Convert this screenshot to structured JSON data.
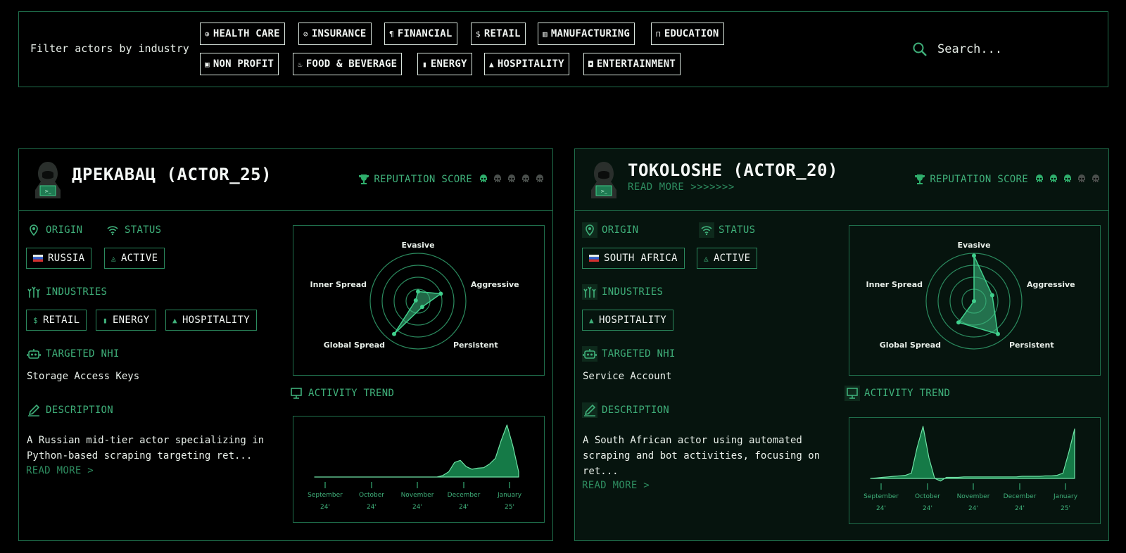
{
  "filter": {
    "label": "Filter actors by industry",
    "chips_row1": [
      {
        "icon": "health-icon",
        "glyph": "⊕",
        "label": "HEALTH CARE"
      },
      {
        "icon": "insurance-icon",
        "glyph": "⊘",
        "label": "INSURANCE"
      },
      {
        "icon": "financial-icon",
        "glyph": "¶",
        "label": "FINANCIAL"
      },
      {
        "icon": "dollar-icon",
        "glyph": "$",
        "label": "RETAIL"
      },
      {
        "icon": "factory-icon",
        "glyph": "▥",
        "label": "MANUFACTURING"
      },
      {
        "icon": "bookmark-icon",
        "glyph": "⊓",
        "label": "EDUCATION"
      }
    ],
    "chips_row2": [
      {
        "icon": "nonprofit-icon",
        "glyph": "▣",
        "label": "NON PROFIT"
      },
      {
        "icon": "food-icon",
        "glyph": "♨",
        "label": "FOOD & BEVERAGE"
      },
      {
        "icon": "battery-icon",
        "glyph": "▮",
        "label": "ENERGY"
      },
      {
        "icon": "bell-desk-icon",
        "glyph": "▲",
        "label": "HOSPITALITY"
      },
      {
        "icon": "ticket-icon",
        "glyph": "◘",
        "label": "ENTERTAINMENT"
      }
    ],
    "search_placeholder": "Search..."
  },
  "actors": [
    {
      "name": "ДРЕКАВАЦ (ACTOR_25)",
      "read_more_header": "",
      "reputation_label": "REPUTATION SCORE",
      "reputation_score": 1,
      "reputation_max": 5,
      "origin_label": "ORIGIN",
      "origin": "RUSSIA",
      "status_label": "STATUS",
      "status": "ACTIVE",
      "industries_label": "INDUSTRIES",
      "industries": [
        {
          "glyph": "$",
          "label": "RETAIL"
        },
        {
          "glyph": "▮",
          "label": "ENERGY"
        },
        {
          "glyph": "▲",
          "label": "HOSPITALITY"
        }
      ],
      "nhi_label": "TARGETED NHI",
      "nhi": "Storage Access Keys",
      "description_label": "DESCRIPTION",
      "description": "A Russian mid-tier actor specializing in Python-based scraping targeting ret...",
      "read_more": "READ MORE >",
      "radar": {
        "axes": [
          "Evasive",
          "Aggressive",
          "Persistent",
          "Global Spread",
          "Inner Spread"
        ],
        "values": [
          0.2,
          0.5,
          0.15,
          0.85,
          0.05
        ]
      },
      "trend_label": "ACTIVITY TREND",
      "trend": {
        "months": [
          "September",
          "October",
          "November",
          "December",
          "January"
        ],
        "years": [
          "24'",
          "24'",
          "24'",
          "24'",
          "25'"
        ],
        "values": [
          0,
          0,
          0,
          0,
          0,
          0,
          0,
          0,
          0,
          0,
          0,
          0,
          0,
          0,
          0,
          0,
          0,
          0,
          0,
          0,
          0,
          0,
          0.03,
          0.1,
          0.28,
          0.32,
          0.2,
          0.15,
          0.17,
          0.18,
          0.25,
          0.36,
          0.7,
          1.0,
          0.6,
          0.1
        ]
      }
    },
    {
      "name": "TOKOLOSHE (ACTOR_20)",
      "read_more_header": "READ MORE >>>>>>>",
      "reputation_label": "REPUTATION SCORE",
      "reputation_score": 3,
      "reputation_max": 5,
      "origin_label": "ORIGIN",
      "origin": "SOUTH AFRICA",
      "status_label": "STATUS",
      "status": "ACTIVE",
      "industries_label": "INDUSTRIES",
      "industries": [
        {
          "glyph": "▲",
          "label": "HOSPITALITY"
        }
      ],
      "nhi_label": "TARGETED NHI",
      "nhi": "Service Account",
      "description_label": "DESCRIPTION",
      "description": "A South African actor using automated scraping and bot activities, focusing on ret...",
      "read_more": "READ MORE >",
      "radar": {
        "axes": [
          "Evasive",
          "Aggressive",
          "Persistent",
          "Global Spread",
          "Inner Spread"
        ],
        "values": [
          0.95,
          0.4,
          0.85,
          0.55,
          0.0
        ]
      },
      "trend_label": "ACTIVITY TREND",
      "trend": {
        "months": [
          "September",
          "October",
          "November",
          "December",
          "January"
        ],
        "years": [
          "24'",
          "24'",
          "24'",
          "24'",
          "25'"
        ],
        "values": [
          0,
          0.01,
          0.02,
          0.03,
          0.04,
          0.05,
          0.06,
          0.1,
          0.6,
          1.0,
          0.4,
          0.0,
          -0.05,
          0.02,
          0.02,
          0.02,
          0.03,
          0.03,
          0.03,
          0.03,
          0.03,
          0.03,
          0.03,
          0.03,
          0.03,
          0.03,
          0.04,
          0.04,
          0.04,
          0.04,
          0.05,
          0.05,
          0.06,
          0.1,
          0.5,
          0.95
        ]
      }
    }
  ]
}
